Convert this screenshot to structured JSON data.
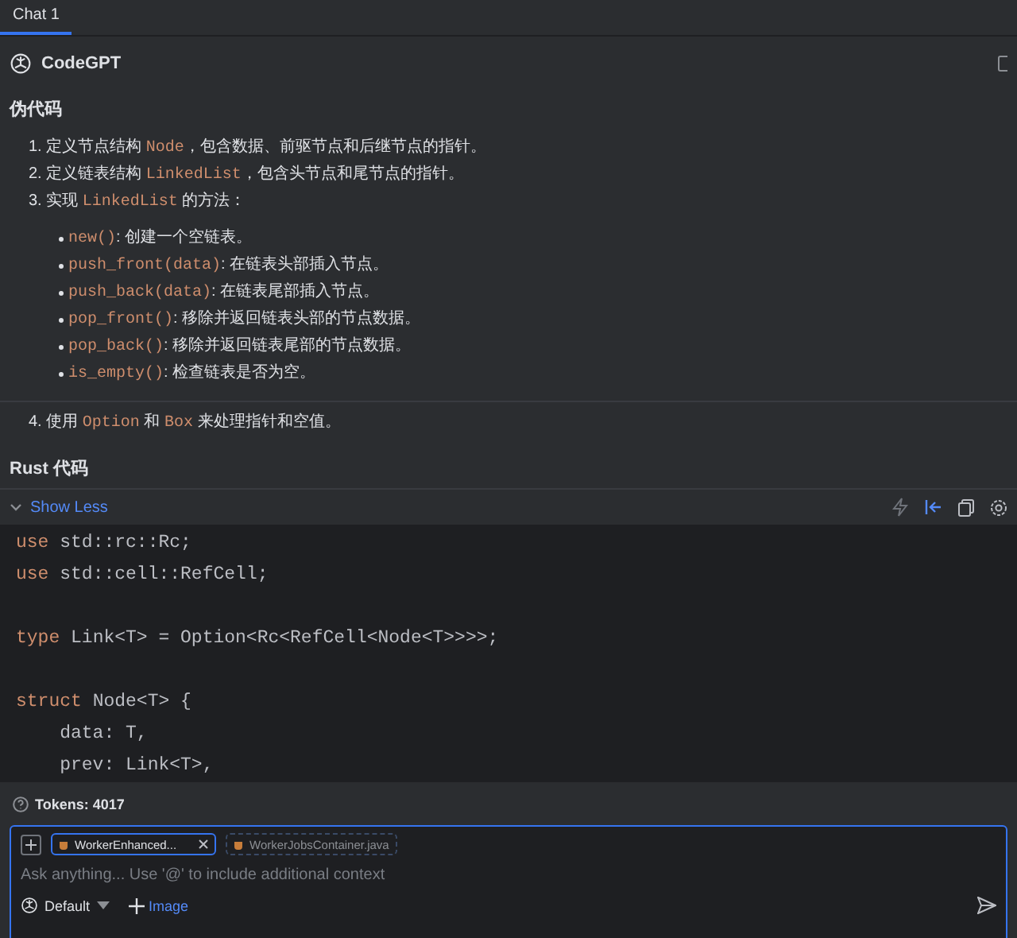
{
  "tabs": [
    {
      "label": "Chat 1",
      "selected": true
    }
  ],
  "message": {
    "author": "CodeGPT",
    "heading": "伪代码",
    "steps": [
      {
        "number": "1.",
        "parts": [
          {
            "kind": "text",
            "text": "定义节点结构 "
          },
          {
            "kind": "code",
            "text": "Node"
          },
          {
            "kind": "text",
            "text": "，包含数据、前驱节点和后继节点的指针。"
          }
        ]
      },
      {
        "number": "2.",
        "parts": [
          {
            "kind": "text",
            "text": "定义链表结构 "
          },
          {
            "kind": "code",
            "text": "LinkedList"
          },
          {
            "kind": "text",
            "text": "，包含头节点和尾节点的指针。"
          }
        ]
      },
      {
        "number": "3.",
        "parts": [
          {
            "kind": "text",
            "text": "实现 "
          },
          {
            "kind": "code",
            "text": "LinkedList"
          },
          {
            "kind": "text",
            "text": " 的方法："
          }
        ],
        "methods": [
          {
            "code": "new()",
            "text": ": 创建一个空链表。"
          },
          {
            "code": "push_front(data)",
            "text": ": 在链表头部插入节点。"
          },
          {
            "code": "push_back(data)",
            "text": ": 在链表尾部插入节点。"
          },
          {
            "code": "pop_front()",
            "text": ": 移除并返回链表头部的节点数据。"
          },
          {
            "code": "pop_back()",
            "text": ": 移除并返回链表尾部的节点数据。"
          },
          {
            "code": "is_empty()",
            "text": ": 检查链表是否为空。"
          }
        ]
      },
      {
        "number": "4.",
        "parts": [
          {
            "kind": "text",
            "text": "使用 "
          },
          {
            "kind": "code",
            "text": "Option"
          },
          {
            "kind": "text",
            "text": " 和 "
          },
          {
            "kind": "code",
            "text": "Box"
          },
          {
            "kind": "text",
            "text": " 来处理指针和空值。"
          }
        ]
      }
    ],
    "code_heading": "Rust 代码",
    "code_block": {
      "toggle": "Show Less",
      "expanded": true,
      "lines": [
        {
          "kind": "code",
          "keyword": "use",
          "rest": " std::rc::Rc;"
        },
        {
          "kind": "code",
          "keyword": "use",
          "rest": " std::cell::RefCell;"
        },
        {
          "kind": "blank"
        },
        {
          "kind": "code",
          "keyword": "type",
          "rest": " Link<T> = Option<Rc<RefCell<Node<T>>>>;"
        },
        {
          "kind": "blank"
        },
        {
          "kind": "code",
          "keyword": "struct",
          "rest": " Node<T> {"
        },
        {
          "kind": "code",
          "rest": "    data: T,"
        },
        {
          "kind": "code",
          "rest": "    prev: Link<T>,"
        }
      ]
    }
  },
  "tokens": "Tokens: 4017",
  "input": {
    "files": [
      {
        "name": "WorkerEnhanced...",
        "selected": true
      },
      {
        "name": "WorkerJobsContainer.java",
        "selected": false
      }
    ],
    "placeholder": "Ask anything... Use '@' to include additional context",
    "model": "Default",
    "image_button": "Image"
  }
}
